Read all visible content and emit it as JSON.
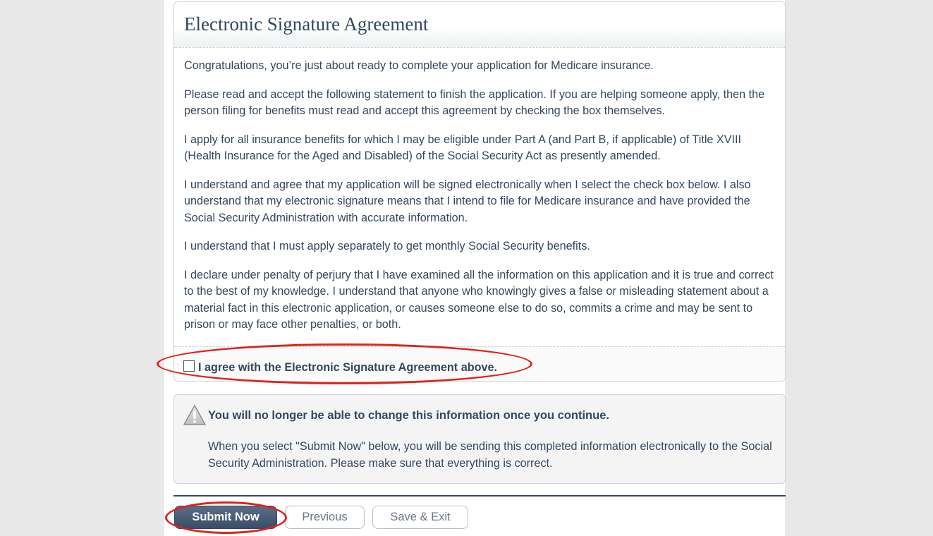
{
  "agreement": {
    "title": "Electronic Signature Agreement",
    "paragraphs": [
      "Congratulations, you’re just about ready to complete your application for Medicare insurance.",
      "Please read and accept the following statement to finish the application. If you are helping someone apply, then the person filing for benefits must read and accept this agreement by checking the box themselves.",
      "I apply for all insurance benefits for which I may be eligible under Part A (and Part B, if applicable) of Title XVIII (Health Insurance for the Aged and Disabled) of the Social Security Act as presently amended.",
      "I understand and agree that my application will be signed electronically when I select the check box below. I also understand that my electronic signature means that I intend to file for Medicare insurance and have provided the Social Security Administration with accurate information.",
      "I understand that I must apply separately to get monthly Social Security benefits.",
      "I declare under penalty of perjury that I have examined all the information on this application and it is true and correct to the best of my knowledge. I understand that anyone who knowingly gives a false or misleading statement about a material fact in this electronic application, or causes someone else to do so, commits a crime and may be sent to prison or may face other penalties, or both."
    ],
    "checkbox_label": "I agree with the Electronic Signature Agreement above.",
    "checkbox_checked": false
  },
  "warning": {
    "icon": "warning-triangle-icon",
    "title": "You will no longer be able to change this information once you continue.",
    "text": "When you select \"Submit Now\" below, you will be sending this completed information electronically to the Social Security Administration. Please make sure that everything is correct."
  },
  "buttons": {
    "submit": "Submit Now",
    "previous": "Previous",
    "save_exit": "Save & Exit"
  },
  "colors": {
    "text": "#34475e",
    "primary_button": "#3b4d66",
    "highlight_ellipse": "#e0221b",
    "side_background": "#e8e8e8"
  }
}
